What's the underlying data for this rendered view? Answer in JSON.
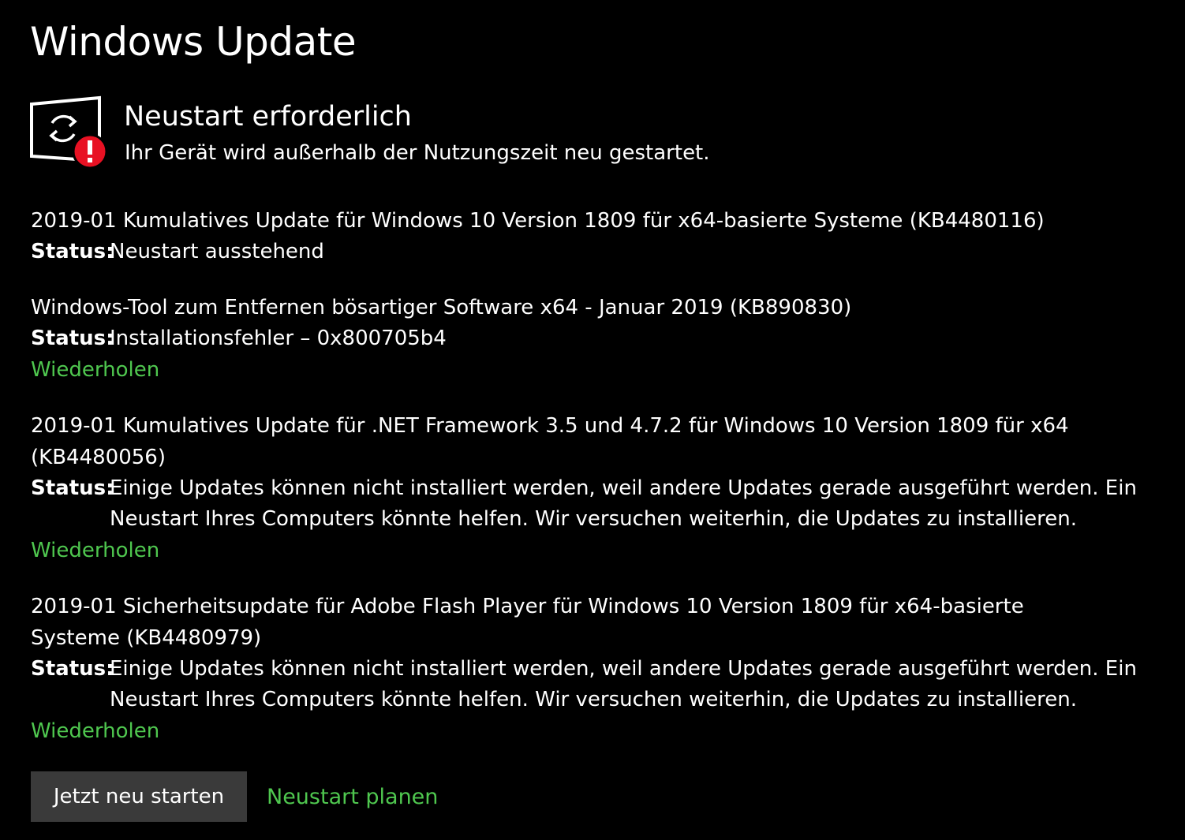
{
  "header": {
    "title": "Windows Update"
  },
  "status": {
    "icon": "restart-required-icon",
    "badge_icon": "error-exclamation-icon",
    "heading": "Neustart erforderlich",
    "subtext": "Ihr Gerät wird außerhalb der Nutzungszeit neu gestartet.",
    "badge_color": "#e81123"
  },
  "updates": [
    {
      "name": "2019-01 Kumulatives Update für Windows 10 Version 1809 für x64-basierte Systeme (KB4480116)",
      "status_label": "Status:",
      "status": "Neustart ausstehend",
      "action": ""
    },
    {
      "name": "Windows-Tool zum Entfernen bösartiger Software x64 - Januar 2019 (KB890830)",
      "status_label": "Status:",
      "status": "Installationsfehler – 0x800705b4",
      "action": "Wiederholen"
    },
    {
      "name": "2019-01 Kumulatives Update für .NET Framework 3.5 und 4.7.2 für Windows 10 Version 1809 für x64 (KB4480056)",
      "status_label": "Status:",
      "status": "Einige Updates können nicht installiert werden, weil andere Updates gerade ausgeführt werden. Ein Neustart Ihres Computers könnte helfen. Wir versuchen weiterhin, die Updates zu installieren.",
      "action": "Wiederholen"
    },
    {
      "name": "2019-01 Sicherheitsupdate für Adobe Flash Player für Windows 10 Version 1809 für x64-basierte Systeme (KB4480979)",
      "status_label": "Status:",
      "status": "Einige Updates können nicht installiert werden, weil andere Updates gerade ausgeführt werden. Ein Neustart Ihres Computers könnte helfen. Wir versuchen weiterhin, die Updates zu installieren.",
      "action": "Wiederholen"
    }
  ],
  "actions": {
    "restart_now": "Jetzt neu starten",
    "schedule_restart": "Neustart planen"
  },
  "colors": {
    "background": "#000000",
    "text": "#ffffff",
    "link": "#4fc74f",
    "button": "#3a3a3a"
  }
}
